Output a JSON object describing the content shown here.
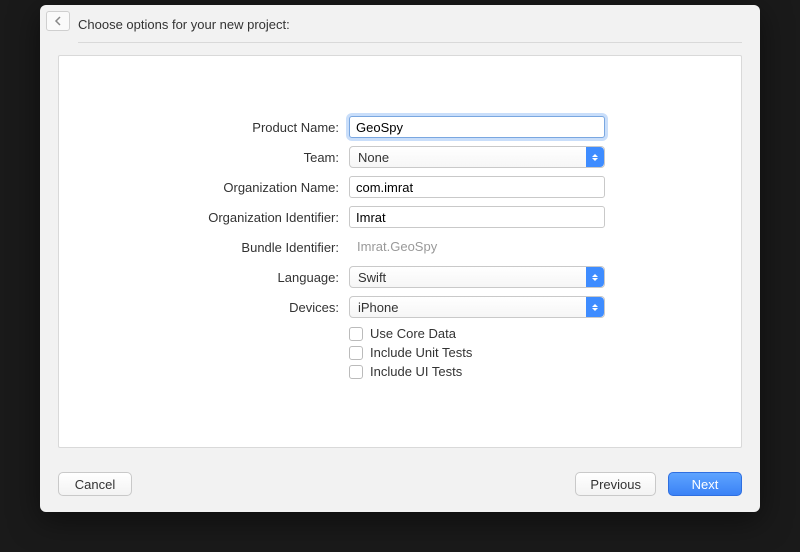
{
  "header": {
    "title": "Choose options for your new project:"
  },
  "form": {
    "labels": {
      "product_name": "Product Name:",
      "team": "Team:",
      "org_name": "Organization Name:",
      "org_identifier": "Organization Identifier:",
      "bundle_identifier": "Bundle Identifier:",
      "language": "Language:",
      "devices": "Devices:"
    },
    "values": {
      "product_name": "GeoSpy",
      "team": "None",
      "org_name": "com.imrat",
      "org_identifier": "Imrat",
      "bundle_identifier": "Imrat.GeoSpy",
      "language": "Swift",
      "devices": "iPhone"
    },
    "checkboxes": {
      "core_data": "Use Core Data",
      "unit_tests": "Include Unit Tests",
      "ui_tests": "Include UI Tests"
    }
  },
  "buttons": {
    "cancel": "Cancel",
    "previous": "Previous",
    "next": "Next"
  }
}
